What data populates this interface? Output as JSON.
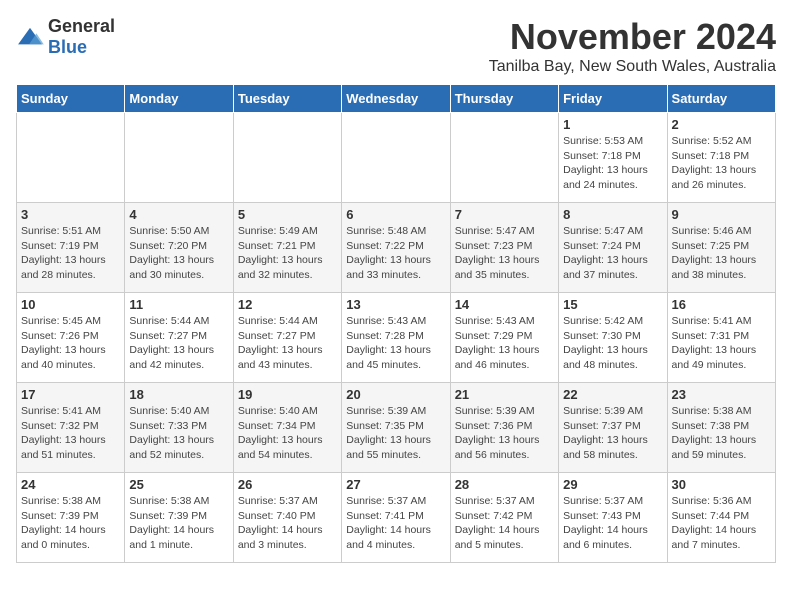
{
  "logo": {
    "general": "General",
    "blue": "Blue"
  },
  "title": "November 2024",
  "location": "Tanilba Bay, New South Wales, Australia",
  "headers": [
    "Sunday",
    "Monday",
    "Tuesday",
    "Wednesday",
    "Thursday",
    "Friday",
    "Saturday"
  ],
  "weeks": [
    [
      {
        "day": "",
        "detail": ""
      },
      {
        "day": "",
        "detail": ""
      },
      {
        "day": "",
        "detail": ""
      },
      {
        "day": "",
        "detail": ""
      },
      {
        "day": "",
        "detail": ""
      },
      {
        "day": "1",
        "detail": "Sunrise: 5:53 AM\nSunset: 7:18 PM\nDaylight: 13 hours\nand 24 minutes."
      },
      {
        "day": "2",
        "detail": "Sunrise: 5:52 AM\nSunset: 7:18 PM\nDaylight: 13 hours\nand 26 minutes."
      }
    ],
    [
      {
        "day": "3",
        "detail": "Sunrise: 5:51 AM\nSunset: 7:19 PM\nDaylight: 13 hours\nand 28 minutes."
      },
      {
        "day": "4",
        "detail": "Sunrise: 5:50 AM\nSunset: 7:20 PM\nDaylight: 13 hours\nand 30 minutes."
      },
      {
        "day": "5",
        "detail": "Sunrise: 5:49 AM\nSunset: 7:21 PM\nDaylight: 13 hours\nand 32 minutes."
      },
      {
        "day": "6",
        "detail": "Sunrise: 5:48 AM\nSunset: 7:22 PM\nDaylight: 13 hours\nand 33 minutes."
      },
      {
        "day": "7",
        "detail": "Sunrise: 5:47 AM\nSunset: 7:23 PM\nDaylight: 13 hours\nand 35 minutes."
      },
      {
        "day": "8",
        "detail": "Sunrise: 5:47 AM\nSunset: 7:24 PM\nDaylight: 13 hours\nand 37 minutes."
      },
      {
        "day": "9",
        "detail": "Sunrise: 5:46 AM\nSunset: 7:25 PM\nDaylight: 13 hours\nand 38 minutes."
      }
    ],
    [
      {
        "day": "10",
        "detail": "Sunrise: 5:45 AM\nSunset: 7:26 PM\nDaylight: 13 hours\nand 40 minutes."
      },
      {
        "day": "11",
        "detail": "Sunrise: 5:44 AM\nSunset: 7:27 PM\nDaylight: 13 hours\nand 42 minutes."
      },
      {
        "day": "12",
        "detail": "Sunrise: 5:44 AM\nSunset: 7:27 PM\nDaylight: 13 hours\nand 43 minutes."
      },
      {
        "day": "13",
        "detail": "Sunrise: 5:43 AM\nSunset: 7:28 PM\nDaylight: 13 hours\nand 45 minutes."
      },
      {
        "day": "14",
        "detail": "Sunrise: 5:43 AM\nSunset: 7:29 PM\nDaylight: 13 hours\nand 46 minutes."
      },
      {
        "day": "15",
        "detail": "Sunrise: 5:42 AM\nSunset: 7:30 PM\nDaylight: 13 hours\nand 48 minutes."
      },
      {
        "day": "16",
        "detail": "Sunrise: 5:41 AM\nSunset: 7:31 PM\nDaylight: 13 hours\nand 49 minutes."
      }
    ],
    [
      {
        "day": "17",
        "detail": "Sunrise: 5:41 AM\nSunset: 7:32 PM\nDaylight: 13 hours\nand 51 minutes."
      },
      {
        "day": "18",
        "detail": "Sunrise: 5:40 AM\nSunset: 7:33 PM\nDaylight: 13 hours\nand 52 minutes."
      },
      {
        "day": "19",
        "detail": "Sunrise: 5:40 AM\nSunset: 7:34 PM\nDaylight: 13 hours\nand 54 minutes."
      },
      {
        "day": "20",
        "detail": "Sunrise: 5:39 AM\nSunset: 7:35 PM\nDaylight: 13 hours\nand 55 minutes."
      },
      {
        "day": "21",
        "detail": "Sunrise: 5:39 AM\nSunset: 7:36 PM\nDaylight: 13 hours\nand 56 minutes."
      },
      {
        "day": "22",
        "detail": "Sunrise: 5:39 AM\nSunset: 7:37 PM\nDaylight: 13 hours\nand 58 minutes."
      },
      {
        "day": "23",
        "detail": "Sunrise: 5:38 AM\nSunset: 7:38 PM\nDaylight: 13 hours\nand 59 minutes."
      }
    ],
    [
      {
        "day": "24",
        "detail": "Sunrise: 5:38 AM\nSunset: 7:39 PM\nDaylight: 14 hours\nand 0 minutes."
      },
      {
        "day": "25",
        "detail": "Sunrise: 5:38 AM\nSunset: 7:39 PM\nDaylight: 14 hours\nand 1 minute."
      },
      {
        "day": "26",
        "detail": "Sunrise: 5:37 AM\nSunset: 7:40 PM\nDaylight: 14 hours\nand 3 minutes."
      },
      {
        "day": "27",
        "detail": "Sunrise: 5:37 AM\nSunset: 7:41 PM\nDaylight: 14 hours\nand 4 minutes."
      },
      {
        "day": "28",
        "detail": "Sunrise: 5:37 AM\nSunset: 7:42 PM\nDaylight: 14 hours\nand 5 minutes."
      },
      {
        "day": "29",
        "detail": "Sunrise: 5:37 AM\nSunset: 7:43 PM\nDaylight: 14 hours\nand 6 minutes."
      },
      {
        "day": "30",
        "detail": "Sunrise: 5:36 AM\nSunset: 7:44 PM\nDaylight: 14 hours\nand 7 minutes."
      }
    ]
  ]
}
